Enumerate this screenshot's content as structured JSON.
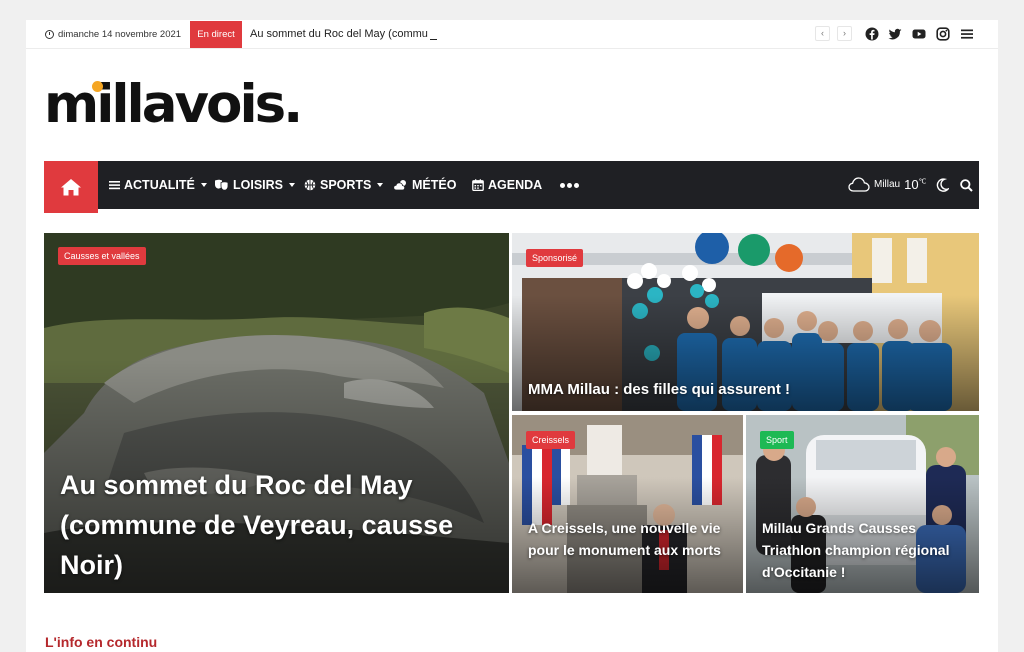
{
  "topbar": {
    "date": "dimanche 14 novembre 2021",
    "live_label": "En direct",
    "ticker_text": "Au sommet du Roc del May (commu",
    "prev": "‹",
    "next": "›",
    "icons": [
      "facebook-icon",
      "twitter-icon",
      "youtube-icon",
      "instagram-icon",
      "menu-icon"
    ]
  },
  "logo": {
    "text": "millavois.",
    "dot_color": "#f5a623"
  },
  "nav": {
    "items": [
      {
        "label": "ACTUALITÉ",
        "icon": "list-icon",
        "dropdown": true
      },
      {
        "label": "LOISIRS",
        "icon": "masks-icon",
        "dropdown": true
      },
      {
        "label": "SPORTS",
        "icon": "ball-icon",
        "dropdown": true
      },
      {
        "label": "MÉTÉO",
        "icon": "cloud-sun-icon",
        "dropdown": false
      },
      {
        "label": "AGENDA",
        "icon": "calendar-icon",
        "dropdown": false
      }
    ],
    "weather_city": "Millau",
    "weather_temp": "10",
    "weather_unit": "℃"
  },
  "articles": [
    {
      "category": "Causses et vallées",
      "title": "Au sommet du Roc del May (commune de Veyreau, causse Noir)",
      "badge_color": "#e03a3e"
    },
    {
      "category": "Sponsorisé",
      "title": "MMA Millau : des filles qui assurent !",
      "badge_color": "#e03a3e"
    },
    {
      "category": "Creissels",
      "title": "A Creissels, une nouvelle vie pour le monument aux morts",
      "badge_color": "#e03a3e"
    },
    {
      "category": "Sport",
      "title": "Millau Grands Causses Triathlon champion régional d'Occitanie !",
      "badge_color": "#1db954"
    }
  ],
  "section": {
    "title": "L'info en continu"
  },
  "colors": {
    "accent": "#e03a3e",
    "nav_bg": "#1f2024",
    "section_title": "#b5282c"
  }
}
